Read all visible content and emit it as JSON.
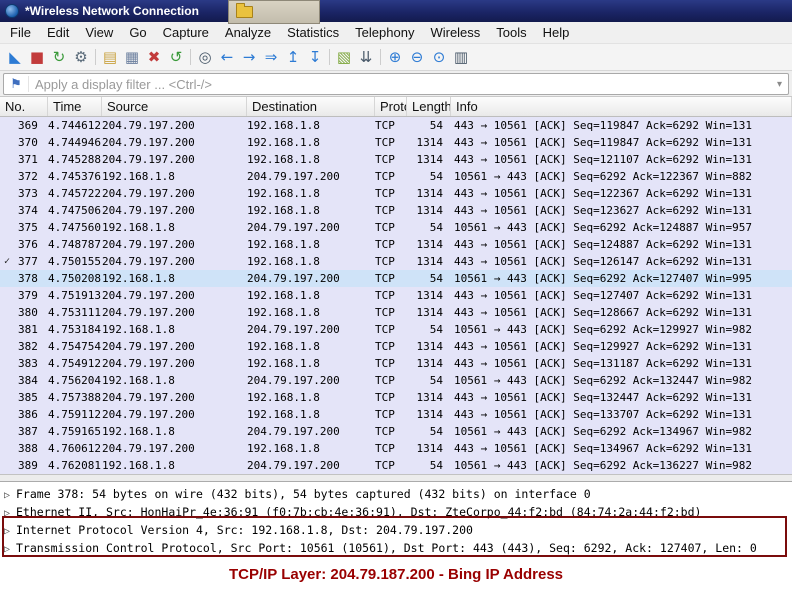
{
  "window": {
    "title": "*Wireless Network Connection"
  },
  "menu": {
    "items": [
      "File",
      "Edit",
      "View",
      "Go",
      "Capture",
      "Analyze",
      "Statistics",
      "Telephony",
      "Wireless",
      "Tools",
      "Help"
    ]
  },
  "toolbar": {
    "groups": [
      [
        {
          "name": "start-capture-icon",
          "glyph": "◣",
          "color": "#2d7bd4"
        },
        {
          "name": "stop-capture-icon",
          "glyph": "■",
          "color": "#c23b3b"
        },
        {
          "name": "restart-capture-icon",
          "glyph": "↻",
          "color": "#3a9a3a"
        },
        {
          "name": "capture-options-icon",
          "glyph": "⚙",
          "color": "#5a6b7a"
        }
      ],
      [
        {
          "name": "open-file-icon",
          "glyph": "▤",
          "color": "#c9a23f"
        },
        {
          "name": "save-file-icon",
          "glyph": "▦",
          "color": "#6b7f9e"
        },
        {
          "name": "close-file-icon",
          "glyph": "✖",
          "color": "#c23b3b"
        },
        {
          "name": "reload-icon",
          "glyph": "↺",
          "color": "#3a9a3a"
        }
      ],
      [
        {
          "name": "find-packet-icon",
          "glyph": "◎",
          "color": "#4a5a6a"
        },
        {
          "name": "go-back-icon",
          "glyph": "←",
          "color": "#2d7bd4"
        },
        {
          "name": "go-forward-icon",
          "glyph": "→",
          "color": "#2d7bd4"
        },
        {
          "name": "go-to-packet-icon",
          "glyph": "⇒",
          "color": "#2d7bd4"
        },
        {
          "name": "go-first-packet-icon",
          "glyph": "↥",
          "color": "#2d7bd4"
        },
        {
          "name": "go-last-packet-icon",
          "glyph": "↧",
          "color": "#2d7bd4"
        }
      ],
      [
        {
          "name": "colorize-packets-icon",
          "glyph": "▧",
          "color": "#7aa537"
        },
        {
          "name": "autoscroll-icon",
          "glyph": "⇊",
          "color": "#4a5a6a"
        }
      ],
      [
        {
          "name": "zoom-in-icon",
          "glyph": "⊕",
          "color": "#2d7bd4"
        },
        {
          "name": "zoom-out-icon",
          "glyph": "⊖",
          "color": "#2d7bd4"
        },
        {
          "name": "zoom-reset-icon",
          "glyph": "⊙",
          "color": "#2d7bd4"
        },
        {
          "name": "resize-columns-icon",
          "glyph": "▥",
          "color": "#4a5a6a"
        }
      ]
    ]
  },
  "filter": {
    "placeholder": "Apply a display filter ... <Ctrl-/>",
    "bookmark_icon": "⚑",
    "dropdown_icon": "▾"
  },
  "packet_list": {
    "columns": [
      "No.",
      "Time",
      "Source",
      "Destination",
      "Protoc",
      "Length",
      "Info"
    ],
    "selected_no": "378",
    "rows": [
      {
        "marker": "",
        "no": "369",
        "time": "4.744612",
        "source": "204.79.197.200",
        "destination": "192.168.1.8",
        "protocol": "TCP",
        "length": "54",
        "info": "443 → 10561 [ACK] Seq=119847 Ack=6292 Win=131"
      },
      {
        "marker": "",
        "no": "370",
        "time": "4.744946",
        "source": "204.79.197.200",
        "destination": "192.168.1.8",
        "protocol": "TCP",
        "length": "1314",
        "info": "443 → 10561 [ACK] Seq=119847 Ack=6292 Win=131"
      },
      {
        "marker": "",
        "no": "371",
        "time": "4.745288",
        "source": "204.79.197.200",
        "destination": "192.168.1.8",
        "protocol": "TCP",
        "length": "1314",
        "info": "443 → 10561 [ACK] Seq=121107 Ack=6292 Win=131"
      },
      {
        "marker": "",
        "no": "372",
        "time": "4.745376",
        "source": "192.168.1.8",
        "destination": "204.79.197.200",
        "protocol": "TCP",
        "length": "54",
        "info": "10561 → 443 [ACK] Seq=6292 Ack=122367 Win=882"
      },
      {
        "marker": "",
        "no": "373",
        "time": "4.745722",
        "source": "204.79.197.200",
        "destination": "192.168.1.8",
        "protocol": "TCP",
        "length": "1314",
        "info": "443 → 10561 [ACK] Seq=122367 Ack=6292 Win=131"
      },
      {
        "marker": "",
        "no": "374",
        "time": "4.747506",
        "source": "204.79.197.200",
        "destination": "192.168.1.8",
        "protocol": "TCP",
        "length": "1314",
        "info": "443 → 10561 [ACK] Seq=123627 Ack=6292 Win=131"
      },
      {
        "marker": "",
        "no": "375",
        "time": "4.747560",
        "source": "192.168.1.8",
        "destination": "204.79.197.200",
        "protocol": "TCP",
        "length": "54",
        "info": "10561 → 443 [ACK] Seq=6292 Ack=124887 Win=957"
      },
      {
        "marker": "",
        "no": "376",
        "time": "4.748787",
        "source": "204.79.197.200",
        "destination": "192.168.1.8",
        "protocol": "TCP",
        "length": "1314",
        "info": "443 → 10561 [ACK] Seq=124887 Ack=6292 Win=131"
      },
      {
        "marker": "✓",
        "no": "377",
        "time": "4.750155",
        "source": "204.79.197.200",
        "destination": "192.168.1.8",
        "protocol": "TCP",
        "length": "1314",
        "info": "443 → 10561 [ACK] Seq=126147 Ack=6292 Win=131"
      },
      {
        "marker": "",
        "no": "378",
        "time": "4.750208",
        "source": "192.168.1.8",
        "destination": "204.79.197.200",
        "protocol": "TCP",
        "length": "54",
        "info": "10561 → 443 [ACK] Seq=6292 Ack=127407 Win=995"
      },
      {
        "marker": "",
        "no": "379",
        "time": "4.751913",
        "source": "204.79.197.200",
        "destination": "192.168.1.8",
        "protocol": "TCP",
        "length": "1314",
        "info": "443 → 10561 [ACK] Seq=127407 Ack=6292 Win=131"
      },
      {
        "marker": "",
        "no": "380",
        "time": "4.753111",
        "source": "204.79.197.200",
        "destination": "192.168.1.8",
        "protocol": "TCP",
        "length": "1314",
        "info": "443 → 10561 [ACK] Seq=128667 Ack=6292 Win=131"
      },
      {
        "marker": "",
        "no": "381",
        "time": "4.753184",
        "source": "192.168.1.8",
        "destination": "204.79.197.200",
        "protocol": "TCP",
        "length": "54",
        "info": "10561 → 443 [ACK] Seq=6292 Ack=129927 Win=982"
      },
      {
        "marker": "",
        "no": "382",
        "time": "4.754754",
        "source": "204.79.197.200",
        "destination": "192.168.1.8",
        "protocol": "TCP",
        "length": "1314",
        "info": "443 → 10561 [ACK] Seq=129927 Ack=6292 Win=131"
      },
      {
        "marker": "",
        "no": "383",
        "time": "4.754912",
        "source": "204.79.197.200",
        "destination": "192.168.1.8",
        "protocol": "TCP",
        "length": "1314",
        "info": "443 → 10561 [ACK] Seq=131187 Ack=6292 Win=131"
      },
      {
        "marker": "",
        "no": "384",
        "time": "4.756204",
        "source": "192.168.1.8",
        "destination": "204.79.197.200",
        "protocol": "TCP",
        "length": "54",
        "info": "10561 → 443 [ACK] Seq=6292 Ack=132447 Win=982"
      },
      {
        "marker": "",
        "no": "385",
        "time": "4.757388",
        "source": "204.79.197.200",
        "destination": "192.168.1.8",
        "protocol": "TCP",
        "length": "1314",
        "info": "443 → 10561 [ACK] Seq=132447 Ack=6292 Win=131"
      },
      {
        "marker": "",
        "no": "386",
        "time": "4.759112",
        "source": "204.79.197.200",
        "destination": "192.168.1.8",
        "protocol": "TCP",
        "length": "1314",
        "info": "443 → 10561 [ACK] Seq=133707 Ack=6292 Win=131"
      },
      {
        "marker": "",
        "no": "387",
        "time": "4.759165",
        "source": "192.168.1.8",
        "destination": "204.79.197.200",
        "protocol": "TCP",
        "length": "54",
        "info": "10561 → 443 [ACK] Seq=6292 Ack=134967 Win=982"
      },
      {
        "marker": "",
        "no": "388",
        "time": "4.760612",
        "source": "204.79.197.200",
        "destination": "192.168.1.8",
        "protocol": "TCP",
        "length": "1314",
        "info": "443 → 10561 [ACK] Seq=134967 Ack=6292 Win=131"
      },
      {
        "marker": "",
        "no": "389",
        "time": "4.762081",
        "source": "192.168.1.8",
        "destination": "204.79.197.200",
        "protocol": "TCP",
        "length": "54",
        "info": "10561 → 443 [ACK] Seq=6292 Ack=136227 Win=982"
      }
    ]
  },
  "details": {
    "expand_icon": "▷",
    "lines": [
      "Frame 378: 54 bytes on wire (432 bits), 54 bytes captured (432 bits) on interface 0",
      "Ethernet II, Src: HonHaiPr_4e:36:91 (f0:7b:cb:4e:36:91), Dst: ZteCorpo_44:f2:bd (84:74:2a:44:f2:bd)",
      "Internet Protocol Version 4, Src: 192.168.1.8, Dst: 204.79.197.200",
      "Transmission Control Protocol, Src Port: 10561 (10561), Dst Port: 443 (443), Seq: 6292, Ack: 127407, Len: 0"
    ]
  },
  "annotation": {
    "text": "TCP/IP Layer: 204.79.187.200 - Bing IP Address",
    "box_color": "#7a0c0c"
  }
}
